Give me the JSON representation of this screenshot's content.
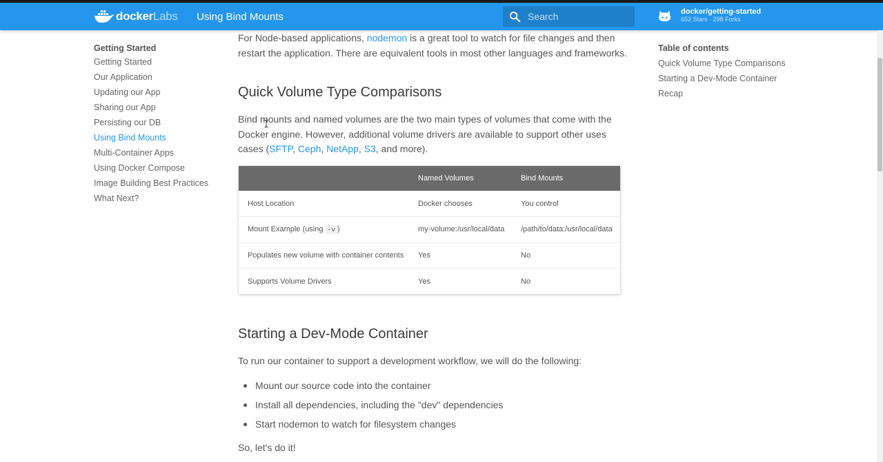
{
  "header": {
    "brand_bold": "docker",
    "brand_light": "Labs",
    "title": "Using Bind Mounts",
    "search_placeholder": "Search",
    "repo_name": "docker/getting-started",
    "repo_stats": "652 Stars · 298 Forks",
    "colors": {
      "bar": "#2496ed",
      "accent": "#2496ed"
    },
    "icons": [
      "docker-whale-icon",
      "search-icon",
      "github-icon"
    ]
  },
  "sidebar": {
    "heading": "Getting Started",
    "items": [
      {
        "label": "Getting Started"
      },
      {
        "label": "Our Application"
      },
      {
        "label": "Updating our App"
      },
      {
        "label": "Sharing our App"
      },
      {
        "label": "Persisting our DB"
      },
      {
        "label": "Using Bind Mounts",
        "active": true
      },
      {
        "label": "Multi-Container Apps"
      },
      {
        "label": "Using Docker Compose"
      },
      {
        "label": "Image Building Best Practices"
      },
      {
        "label": "What Next?"
      }
    ]
  },
  "toc": {
    "heading": "Table of contents",
    "items": [
      {
        "label": "Quick Volume Type Comparisons"
      },
      {
        "label": "Starting a Dev-Mode Container"
      },
      {
        "label": "Recap"
      }
    ]
  },
  "content": {
    "p1_before": "For Node-based applications, ",
    "p1_link": "nodemon",
    "p1_after": " is a great tool to watch for file changes and then restart the application. There are equivalent tools in most other languages and frameworks.",
    "h_comparisons": "Quick Volume Type Comparisons",
    "p2_before": "Bind mounts and named volumes are the two main types of volumes that come with the Docker engine. However, additional volume drivers are available to support other uses cases (",
    "p2_link1": "SFTP",
    "p2_sep1": ", ",
    "p2_link2": "Ceph",
    "p2_sep2": ", ",
    "p2_link3": "NetApp",
    "p2_sep3": ", ",
    "p2_link4": "S3",
    "p2_after": ", and more).",
    "table": {
      "headers": [
        "",
        "Named Volumes",
        "Bind Mounts"
      ],
      "rows": [
        {
          "label": "Host Location",
          "named": "Docker chooses",
          "bind": "You control"
        },
        {
          "label_before": "Mount Example (using ",
          "label_code": "-v",
          "label_after": ")",
          "named": "my-volume:/usr/local/data",
          "bind": "/path/to/data:/usr/local/data"
        },
        {
          "label": "Populates new volume with container contents",
          "named": "Yes",
          "bind": "No"
        },
        {
          "label": "Supports Volume Drivers",
          "named": "Yes",
          "bind": "No"
        }
      ]
    },
    "h_devmode": "Starting a Dev-Mode Container",
    "p3": "To run our container to support a development workflow, we will do the following:",
    "bullets": [
      "Mount our source code into the container",
      "Install all dependencies, including the \"dev\" dependencies",
      "Start nodemon to watch for filesystem changes"
    ],
    "p4": "So, let's do it!"
  }
}
